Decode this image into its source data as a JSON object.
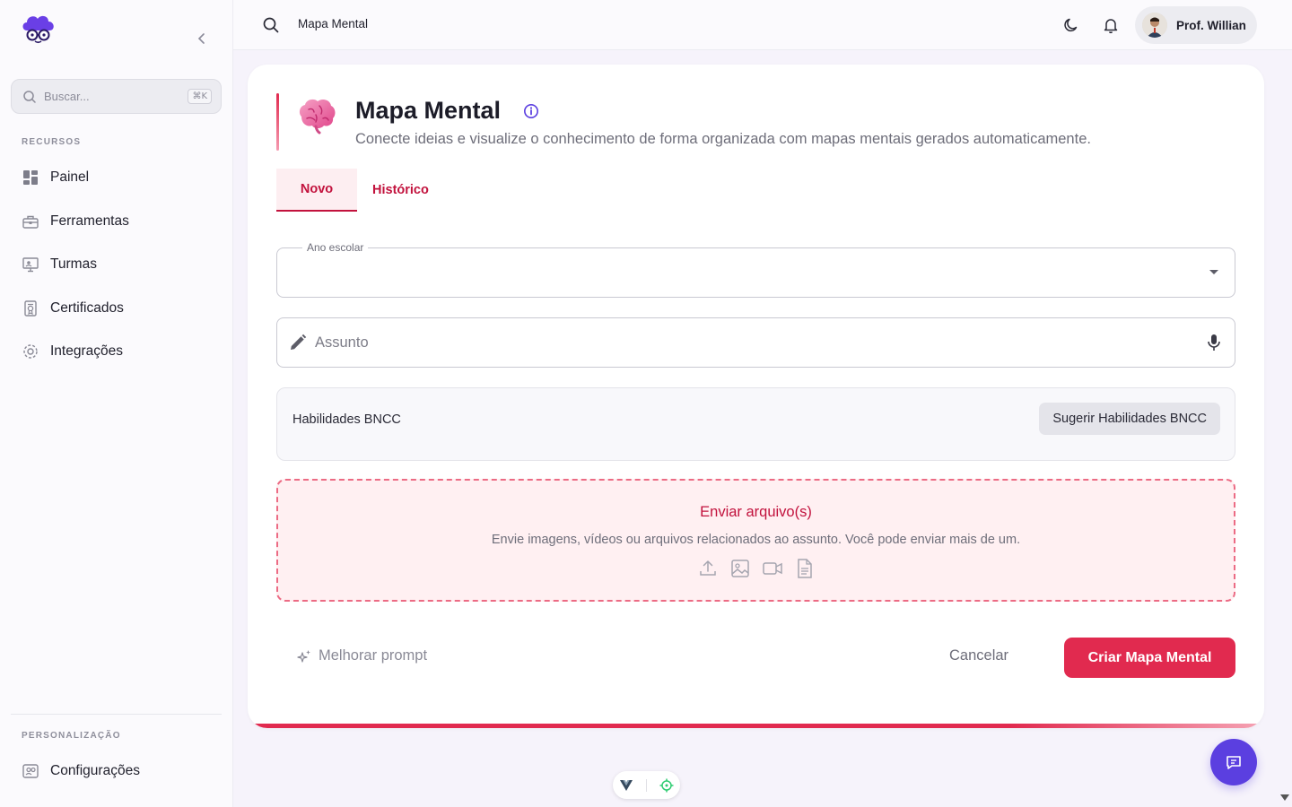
{
  "sidebar": {
    "logo_icon": "brain-cloud-logo",
    "search": {
      "placeholder": "Buscar...",
      "shortcut": "⌘K"
    },
    "section_resources": "RECURSOS",
    "items": [
      {
        "label": "Painel",
        "icon": "dashboard-icon"
      },
      {
        "label": "Ferramentas",
        "icon": "toolbox-icon"
      },
      {
        "label": "Turmas",
        "icon": "classroom-icon"
      },
      {
        "label": "Certificados",
        "icon": "certificate-icon"
      },
      {
        "label": "Integrações",
        "icon": "gear-icon"
      }
    ],
    "section_personalization": "PERSONALIZAÇÃO",
    "settings_label": "Configurações"
  },
  "topbar": {
    "title": "Mapa Mental",
    "user_name": "Prof. Willian"
  },
  "page": {
    "title": "Mapa Mental",
    "subtitle": "Conecte ideias e visualize o conhecimento de forma organizada com mapas mentais gerados automaticamente.",
    "tabs": [
      {
        "label": "Novo",
        "active": true
      },
      {
        "label": "Histórico",
        "active": false
      }
    ]
  },
  "form": {
    "grade_label": "Ano escolar",
    "grade_value": "",
    "subject_placeholder": "Assunto",
    "bncc_label": "Habilidades BNCC",
    "bncc_button": "Sugerir Habilidades BNCC",
    "upload_title": "Enviar arquivo(s)",
    "upload_desc": "Envie imagens, vídeos ou arquivos relacionados ao assunto. Você pode enviar mais de um.",
    "improve_prompt": "Melhorar prompt",
    "cancel": "Cancelar",
    "submit": "Criar Mapa Mental"
  },
  "colors": {
    "accent": "#e12a4f",
    "brand_purple": "#5b3fe0",
    "tab_text": "#c2123d"
  }
}
